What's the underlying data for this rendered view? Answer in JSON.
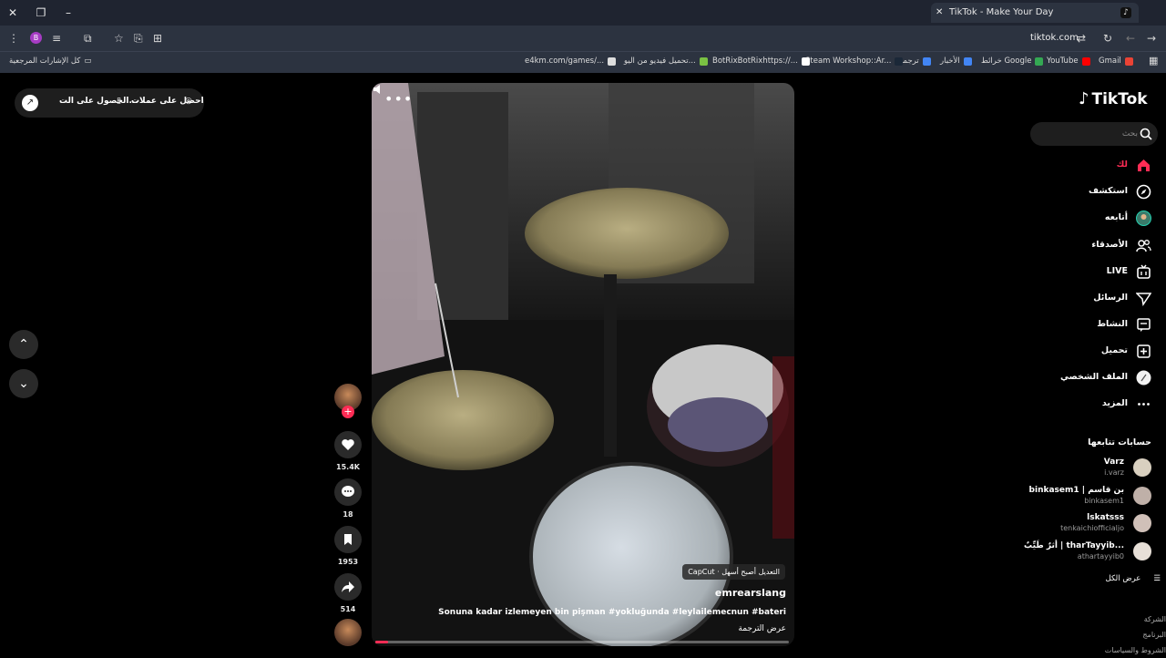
{
  "browser": {
    "tab_title": "TikTok - Make Your Day",
    "url": "tiktok.com",
    "profile_initial": "B",
    "bookmarks_all": "كل الإشارات المرجعية",
    "bookmarks": [
      {
        "label": "Gmail",
        "color": "#ea4335"
      },
      {
        "label": "YouTube",
        "color": "#ff0000"
      },
      {
        "label": "خرائط Google",
        "color": "#34a853"
      },
      {
        "label": "الأخبار",
        "color": "#4285f4"
      },
      {
        "label": "ترجمة",
        "color": "#4285f4"
      },
      {
        "label": "Steam Workshop::Ar...",
        "color": "#1b2838"
      },
      {
        "label": "BotRixBotRixhttps://...",
        "color": "#ffffff"
      },
      {
        "label": "تحميل فيديو من اليو...",
        "color": "#7ac143"
      },
      {
        "label": "e4km.com/games/...",
        "color": "#dddddd"
      }
    ]
  },
  "top_left": {
    "get_coins": "احصل على عملات",
    "get_app": "الحصول على الت..."
  },
  "video": {
    "capcut_badge": "CapCut · التعديل أصبح أسهل",
    "author": "emrearslang",
    "description": "Sonuna kadar izlemeyen bin pişman #yokluğunda #leylailemecnun #bateri",
    "translate": "عرض الترجمة",
    "progress": 0.03
  },
  "actions": {
    "likes": "15.4K",
    "comments": "18",
    "saves": "1953",
    "shares": "514"
  },
  "sidebar": {
    "logo": "TikTok",
    "search_placeholder": "بحث",
    "nav": [
      {
        "label": "لك",
        "icon": "home-icon",
        "active": true
      },
      {
        "label": "استكشف",
        "icon": "compass-icon"
      },
      {
        "label": "أتابعه",
        "icon": "following-avatar-icon"
      },
      {
        "label": "الأصدقاء",
        "icon": "friends-icon"
      },
      {
        "label": "LIVE",
        "icon": "live-icon"
      },
      {
        "label": "الرسائل",
        "icon": "messages-icon"
      },
      {
        "label": "النشاط",
        "icon": "activity-icon"
      },
      {
        "label": "تحميل",
        "icon": "upload-icon"
      },
      {
        "label": "الملف الشخصي",
        "icon": "profile-icon"
      },
      {
        "label": "المزيد",
        "icon": "more-icon"
      }
    ],
    "following_title": "حسابات تتابعها",
    "following": [
      {
        "name": "Varz",
        "handle": "i.varz"
      },
      {
        "name": "binkasem1 | بن قاسم",
        "handle": "binkasem1"
      },
      {
        "name": "lskatsss",
        "handle": "tenkaichiofficialjo"
      },
      {
        "name": "أثرٌ طَيِّبٌ | tharTayyib...",
        "handle": "athartayyib0"
      }
    ],
    "see_all": "عرض الكل",
    "footer": [
      "الشركة",
      "البرنامج",
      "الشروط والسياسات"
    ]
  },
  "colors": {
    "accent": "#fe2c55",
    "background": "#000000",
    "chrome": "#2c3340"
  }
}
